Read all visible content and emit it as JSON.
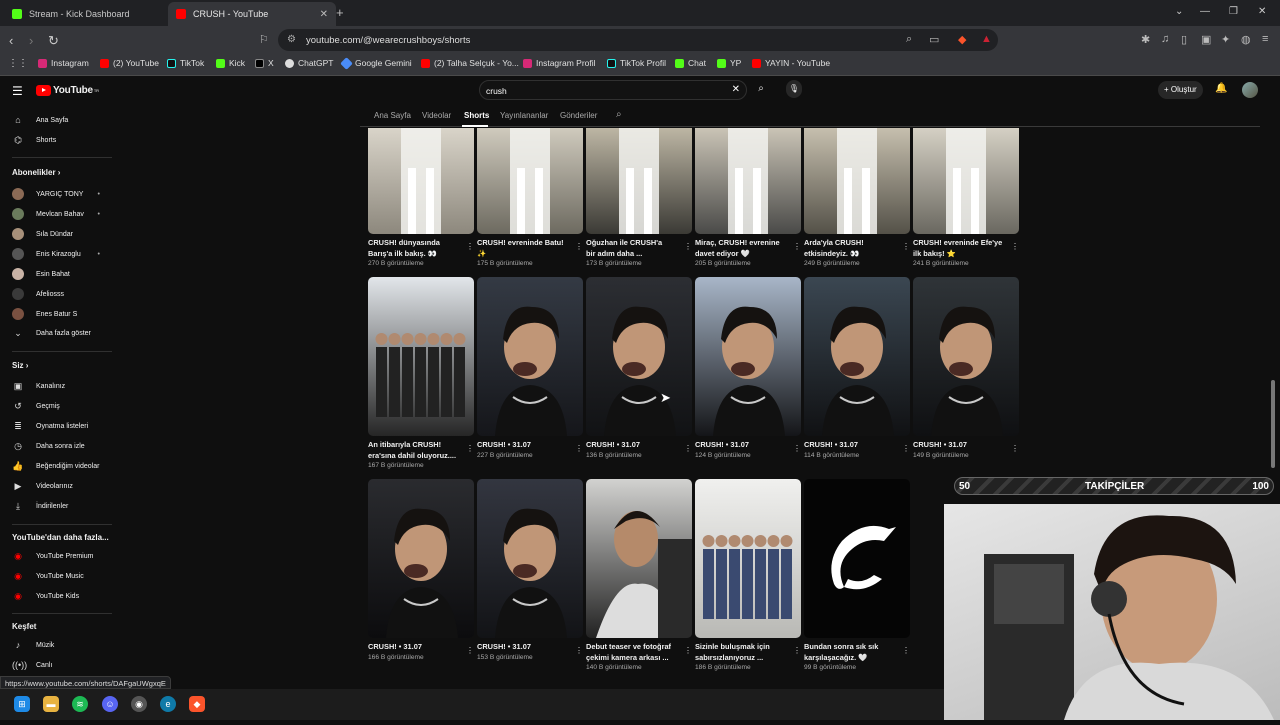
{
  "browser": {
    "tabs": [
      {
        "title": "Stream - Kick Dashboard",
        "icon": "kick-icon",
        "active": false
      },
      {
        "title": "CRUSH - YouTube",
        "icon": "youtube-icon",
        "active": true
      }
    ],
    "url": "youtube.com/@wearecrushboys/shorts",
    "bookmarks": [
      "Instagram",
      "(2) YouTube",
      "TikTok",
      "Kick",
      "X",
      "ChatGPT",
      "Google Gemini",
      "(2) Talha Selçuk - Yo...",
      "Instagram Profil",
      "TikTok Profil",
      "Chat",
      "YP",
      "YAYIN - YouTube"
    ],
    "status_url": "https://www.youtube.com/shorts/DAFgaUWgxqE"
  },
  "masthead": {
    "logo": "YouTube",
    "logo_sup": "TR",
    "search_value": "crush",
    "create_label": "Oluştur"
  },
  "sidebar": {
    "main": [
      "Ana Sayfa",
      "Shorts"
    ],
    "subs_heading": "Abonelikler",
    "subs": [
      "YARGIÇ TONY",
      "Mevlcan Bahav",
      "Sıla Dündar",
      "Enis Kirazoglu",
      "Esin Bahat",
      "Afeliosss",
      "Enes Batur S",
      "Daha fazla göster"
    ],
    "you_heading": "Siz",
    "you": [
      "Kanalınız",
      "Geçmiş",
      "Oynatma listeleri",
      "Daha sonra izle",
      "Beğendiğim videolar",
      "Videolarınız",
      "İndirilenler"
    ],
    "more_heading": "YouTube'dan daha fazla...",
    "more": [
      "YouTube Premium",
      "YouTube Music",
      "YouTube Kids"
    ],
    "explore_heading": "Keşfet",
    "explore": [
      "Müzik",
      "Canlı"
    ]
  },
  "channel_tabs": [
    "Ana Sayfa",
    "Videolar",
    "Shorts",
    "Yayınlananlar",
    "Gönderiler"
  ],
  "shorts": [
    {
      "title": "CRUSH! dünyasında\nBarış'a ilk bakış. 👀",
      "views": "270 B görüntüleme"
    },
    {
      "title": "CRUSH! evreninde Batu!\n✨",
      "views": "175 B görüntüleme"
    },
    {
      "title": "Oğuzhan ile CRUSH'a\nbir adım daha ...",
      "views": "173 B görüntüleme"
    },
    {
      "title": "Miraç, CRUSH! evrenine\ndavet ediyor 🤍",
      "views": "205 B görüntüleme"
    },
    {
      "title": "Arda'yla CRUSH!\netkisindeyiz. 👀",
      "views": "249 B görüntüleme"
    },
    {
      "title": "CRUSH! evreninde Efe'ye\nilk bakış! ⭐",
      "views": "241 B görüntüleme"
    },
    {
      "title": "An itibarıyla CRUSH!\nera'sına dahil oluyoruz....",
      "views": "167 B görüntüleme"
    },
    {
      "title": "CRUSH! • 31.07",
      "views": "227 B görüntüleme"
    },
    {
      "title": "CRUSH! • 31.07",
      "views": "136 B görüntüleme"
    },
    {
      "title": "CRUSH! • 31.07",
      "views": "124 B görüntüleme"
    },
    {
      "title": "CRUSH! • 31.07",
      "views": "114 B görüntüleme"
    },
    {
      "title": "CRUSH! • 31.07",
      "views": "149 B görüntüleme"
    },
    {
      "title": "CRUSH! • 31.07",
      "views": "166 B görüntüleme"
    },
    {
      "title": "CRUSH! • 31.07",
      "views": "153 B görüntüleme"
    },
    {
      "title": "Debut teaser ve fotoğraf\nçekimi kamera arkası ...",
      "views": "140 B görüntüleme"
    },
    {
      "title": "Sizinle buluşmak için\nsabırsızlanıyoruz ...",
      "views": "186 B görüntüleme"
    },
    {
      "title": "Bundan sonra sık sık\nkarşılaşacağız. 🤍",
      "views": "99 B görüntüleme"
    }
  ],
  "overlay": {
    "left": "50",
    "label": "TAKİPÇİLER",
    "right": "100"
  },
  "colors": {
    "bg": "#0f0f0f",
    "brand_red": "#ff0000",
    "text_secondary": "#aaaaaa"
  }
}
